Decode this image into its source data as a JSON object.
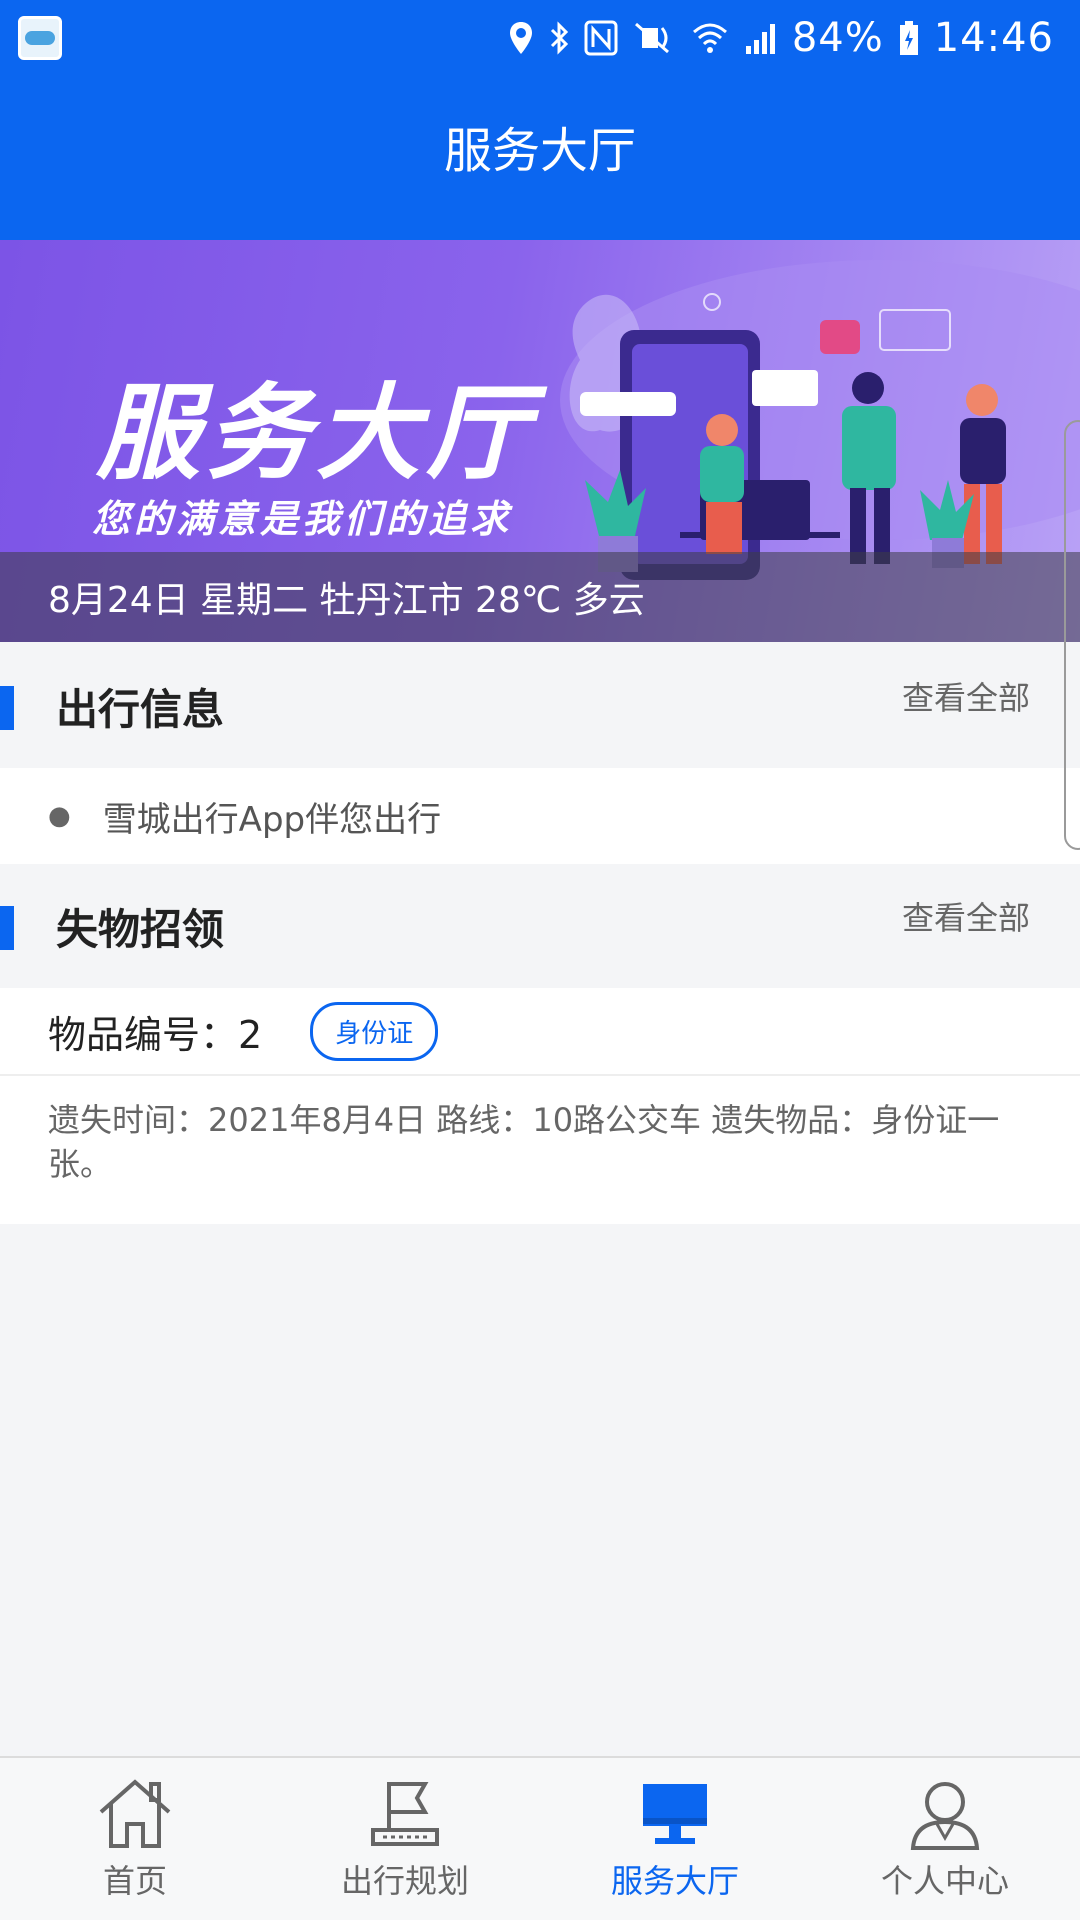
{
  "status_bar": {
    "battery": "84%",
    "time": "14:46",
    "icons": [
      "location-icon",
      "bluetooth-icon",
      "nfc-icon",
      "mute-icon",
      "wifi-icon",
      "signal-icon",
      "battery-icon"
    ]
  },
  "header": {
    "title": "服务大厅"
  },
  "banner": {
    "title": "服务大厅",
    "subtitle": "您的满意是我们的追求",
    "info_line": "8月24日 星期二 牡丹江市 28℃ 多云"
  },
  "travel_info": {
    "title": "出行信息",
    "view_all": "查看全部",
    "items": [
      "雪城出行App伴您出行"
    ]
  },
  "lost_found": {
    "title": "失物招领",
    "view_all": "查看全部",
    "item_no_label": "物品编号：2",
    "tag": "身份证",
    "description": "遗失时间：2021年8月4日 路线：10路公交车 遗失物品：身份证一张。"
  },
  "bottom_nav": {
    "items": [
      {
        "label": "首页",
        "icon": "home-icon",
        "active": false
      },
      {
        "label": "出行规划",
        "icon": "route-flag-icon",
        "active": false
      },
      {
        "label": "服务大厅",
        "icon": "monitor-icon",
        "active": true
      },
      {
        "label": "个人中心",
        "icon": "user-icon",
        "active": false
      }
    ]
  },
  "colors": {
    "primary": "#0b66f0",
    "background": "#f4f5f7",
    "banner_purple": "#7c54e6"
  }
}
